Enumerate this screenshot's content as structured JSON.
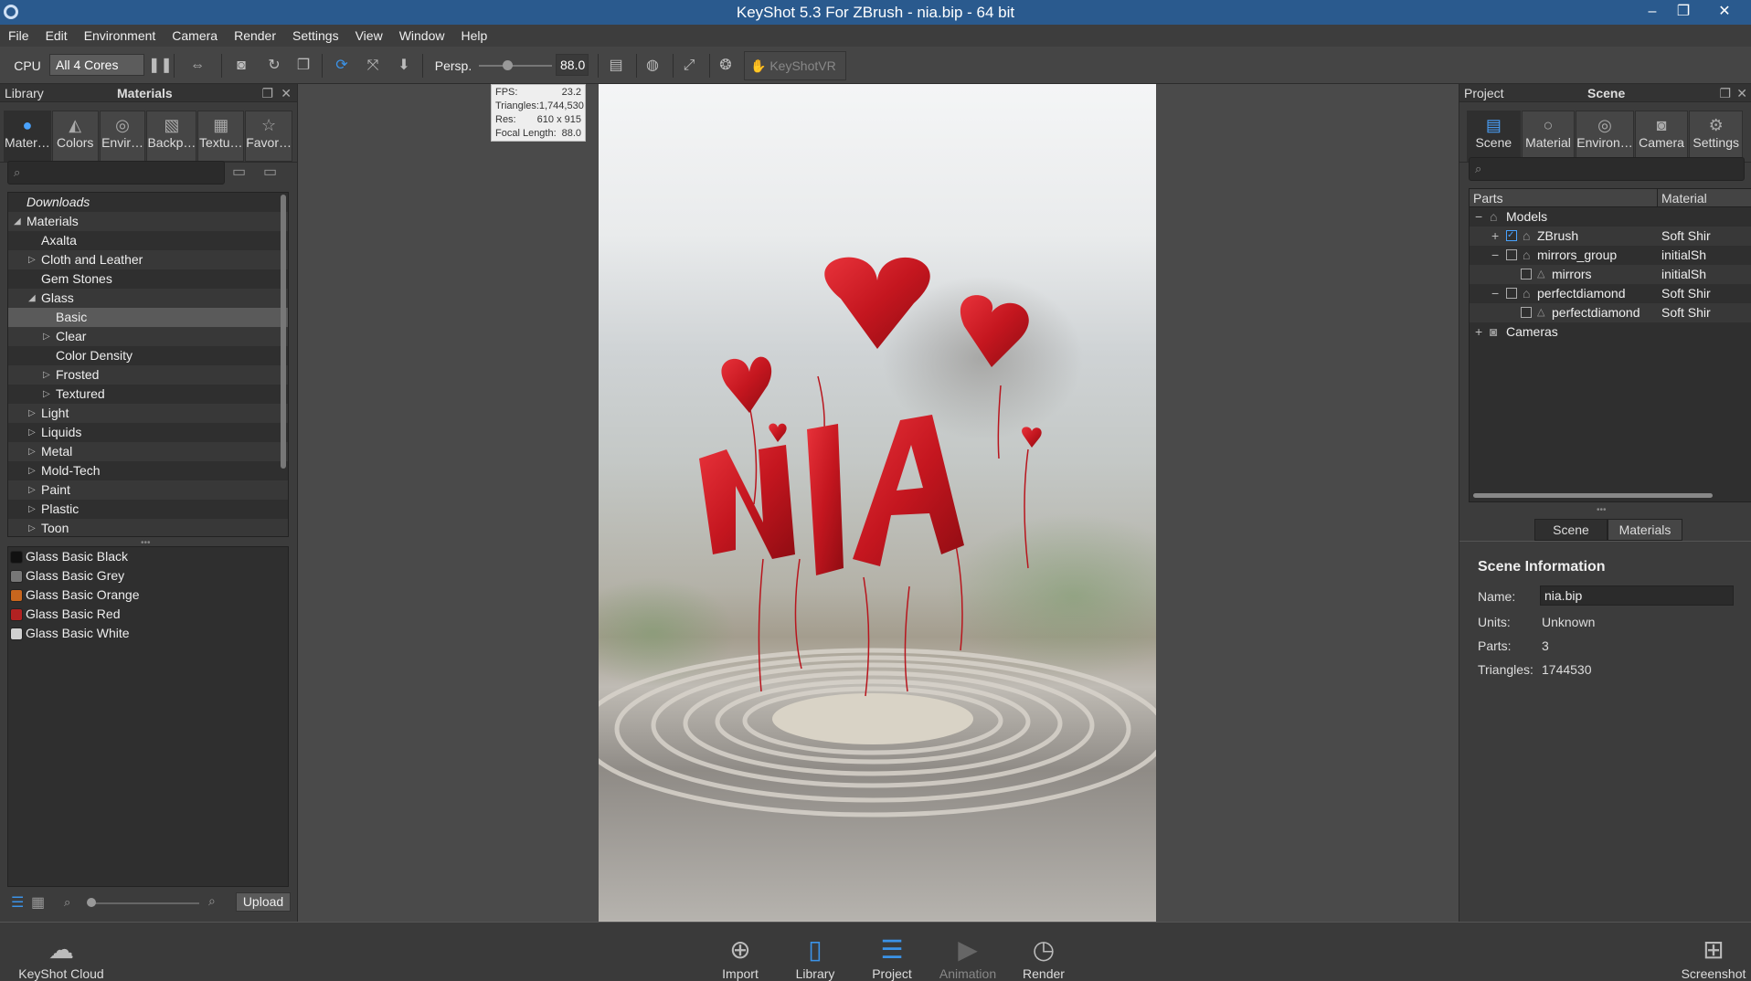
{
  "window": {
    "title": "KeyShot 5.3 For ZBrush - nia.bip  - 64 bit",
    "minimize": "–",
    "restore": "❐",
    "close": "✕"
  },
  "menu": [
    "File",
    "Edit",
    "Environment",
    "Camera",
    "Render",
    "Settings",
    "View",
    "Window",
    "Help"
  ],
  "toolbar": {
    "cpu_label": "CPU",
    "cores_value": "All 4 Cores",
    "perspective_label": "Persp.",
    "fov_value": "88.0",
    "keyshotvr_label": "KeyShotVR"
  },
  "library": {
    "header_left": "Library",
    "header_title": "Materials",
    "tabs": [
      {
        "label": "Mater…",
        "icon": "material-ball-icon"
      },
      {
        "label": "Colors",
        "icon": "palette-icon"
      },
      {
        "label": "Envir…",
        "icon": "globe-icon"
      },
      {
        "label": "Backp…",
        "icon": "image-icon"
      },
      {
        "label": "Textu…",
        "icon": "texture-icon"
      },
      {
        "label": "Favor…",
        "icon": "star-icon"
      }
    ],
    "tree": [
      "Downloads",
      "Materials",
      "Axalta",
      "Cloth and Leather",
      "Gem Stones",
      "Glass",
      "Basic",
      "Clear",
      "Color Density",
      "Frosted",
      "Textured",
      "Light",
      "Liquids",
      "Metal",
      "Mold-Tech",
      "Paint",
      "Plastic",
      "Toon"
    ],
    "materials": [
      {
        "name": "Glass Basic Black",
        "color": "#111111"
      },
      {
        "name": "Glass Basic Grey",
        "color": "#777777"
      },
      {
        "name": "Glass Basic Orange",
        "color": "#c8661e"
      },
      {
        "name": "Glass Basic Red",
        "color": "#b22222"
      },
      {
        "name": "Glass Basic White",
        "color": "#d0d0d0"
      }
    ],
    "upload_label": "Upload"
  },
  "viewport": {
    "stats": [
      {
        "k": "FPS:",
        "v": "23.2"
      },
      {
        "k": "Triangles:",
        "v": "1,744,530"
      },
      {
        "k": "Res:",
        "v": "610 x 915"
      },
      {
        "k": "Focal Length:",
        "v": "88.0"
      }
    ]
  },
  "project": {
    "header_left": "Project",
    "header_title": "Scene",
    "tabs": [
      {
        "label": "Scene",
        "icon": "list-icon"
      },
      {
        "label": "Material",
        "icon": "material-ball-icon"
      },
      {
        "label": "Environ…",
        "icon": "globe-icon"
      },
      {
        "label": "Camera",
        "icon": "camera-icon"
      },
      {
        "label": "Settings",
        "icon": "gear-icon"
      }
    ],
    "cols": {
      "parts": "Parts",
      "material": "Material"
    },
    "rows": [
      {
        "name": "Models",
        "mat": ""
      },
      {
        "name": "ZBrush",
        "mat": "Soft Shir"
      },
      {
        "name": "mirrors_group",
        "mat": "initialSh"
      },
      {
        "name": "mirrors",
        "mat": "initialSh"
      },
      {
        "name": "perfectdiamond",
        "mat": "Soft Shir"
      },
      {
        "name": "perfectdiamond",
        "mat": "Soft Shir"
      },
      {
        "name": "Cameras",
        "mat": ""
      }
    ],
    "subtabs": [
      "Scene",
      "Materials"
    ],
    "info": {
      "title": "Scene Information",
      "name_label": "Name:",
      "name_value": "nia.bip",
      "units_label": "Units:",
      "units_value": "Unknown",
      "parts_label": "Parts:",
      "parts_value": "3",
      "tri_label": "Triangles:",
      "tri_value": "1744530"
    }
  },
  "bottom": {
    "cloud": "KeyShot Cloud",
    "import": "Import",
    "library": "Library",
    "project": "Project",
    "animation": "Animation",
    "render": "Render",
    "screenshot": "Screenshot"
  }
}
